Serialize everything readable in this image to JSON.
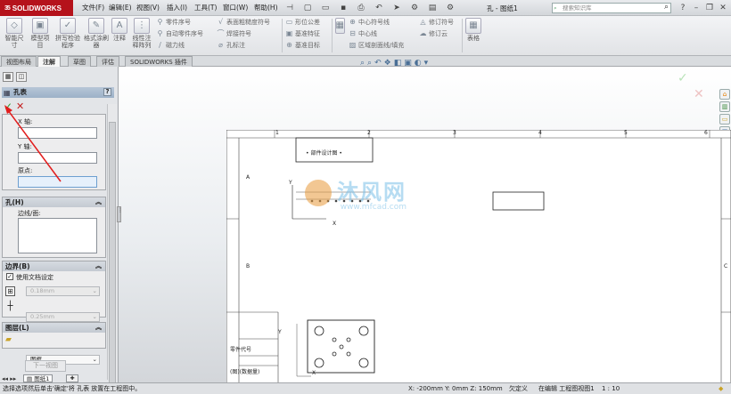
{
  "app": {
    "logo": "SOLIDWORKS",
    "doc_title": "孔 - 图纸1",
    "search_placeholder": "搜索知识库"
  },
  "menu": [
    "文件(F)",
    "编辑(E)",
    "视图(V)",
    "插入(I)",
    "工具(T)",
    "窗口(W)",
    "帮助(H)"
  ],
  "ribbon": {
    "big_buttons": [
      "智能尺寸",
      "模型项目",
      "拼写检验程序",
      "格式涂刷器",
      "注释",
      "线性注释阵列"
    ],
    "col1": [
      "零件序号",
      "自动零件序号",
      "磁力线"
    ],
    "col2": [
      "表面粗糙度符号",
      "焊接符号",
      "孔标注"
    ],
    "col3": [
      "形位公差",
      "基准特征",
      "基准目标"
    ],
    "col4": [
      "中心符号线",
      "中心线",
      "区域剖面线/填充"
    ],
    "col5": [
      "修订符号",
      "修订云"
    ],
    "table_button": "表格"
  },
  "tabs": [
    "视图布局",
    "注解",
    "草图",
    "评估",
    "SOLIDWORKS 插件"
  ],
  "active_tab": "注解",
  "panel": {
    "title": "孔表",
    "ok": "✓",
    "cancel": "✕",
    "x_axis_label": "X 轴:",
    "y_axis_label": "Y 轴:",
    "origin_label": "原点:",
    "hole_group": "孔(H)",
    "edge_label": "边线/面:",
    "border_group": "边界(B)",
    "use_doc_settings": "使用文档设定",
    "border_val1": "0.18mm",
    "border_val2": "0.25mm",
    "layer_group": "图层(L)",
    "layer_value": "图框",
    "next_view": "下一视图"
  },
  "sheet": {
    "col_numbers": [
      "1",
      "2",
      "3",
      "4",
      "5",
      "6"
    ],
    "row_letters": [
      "A",
      "B",
      "C"
    ],
    "title_block": "• 部件设计图 •",
    "cell1": "零件代号",
    "cell2": "(图)(数据量)",
    "axis_x": "X",
    "axis_y": "Y"
  },
  "status": {
    "message": "选择选项然后单击'确定'将 孔表 放置在工程图中。",
    "coords": "X: -200mm Y: 0mm Z: 150mm",
    "state": "欠定义",
    "mode": "在编辑 工程图视图1",
    "scale": "1 : 10"
  },
  "sheet_tab": "图纸1",
  "watermark": {
    "main": "沐风网",
    "sub": "www.mfcad.com"
  }
}
